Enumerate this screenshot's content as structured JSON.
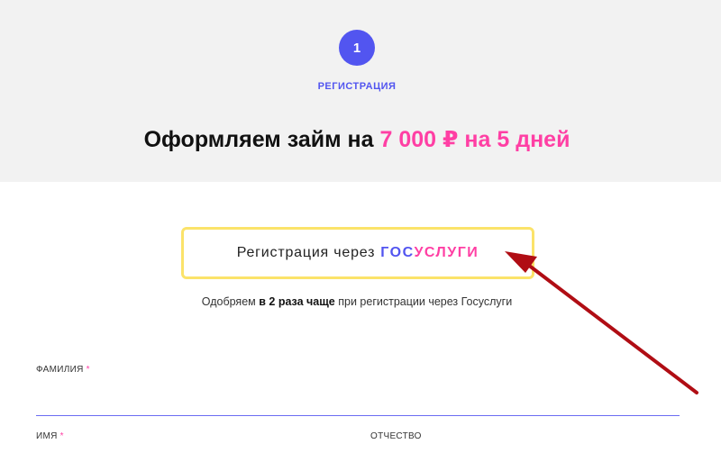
{
  "stepper": {
    "number": "1",
    "label": "РЕГИСТРАЦИЯ"
  },
  "headline": {
    "prefix": "Оформляем займ на",
    "amount": "7 000 ₽",
    "middle": "на",
    "term": "5 дней"
  },
  "gosuslugi_button": {
    "label": "Регистрация через",
    "brand_part1": "ГОС",
    "brand_part2": "УСЛУГИ"
  },
  "note": {
    "before": "Одобряем",
    "bold": "в 2 раза чаще",
    "after": "при регистрации через Госуслуги"
  },
  "form": {
    "surname_label": "ФАМИЛИЯ",
    "name_label": "ИМЯ",
    "patronymic_label": "ОТЧЕСТВО",
    "required_mark": "*"
  },
  "colors": {
    "accent_blue": "#5255f0",
    "accent_pink": "#ff3fa4",
    "button_border": "#fbe36a",
    "arrow": "#b00d14"
  }
}
